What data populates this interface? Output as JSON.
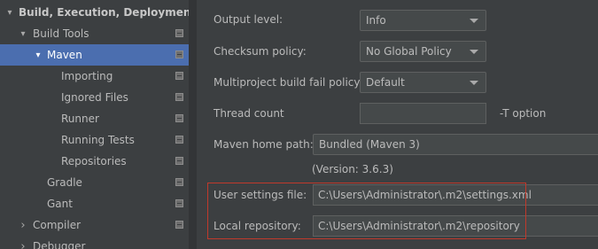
{
  "tree": {
    "items": [
      {
        "label": "Build, Execution, Deployment",
        "arrow": "▾",
        "bold": true,
        "icon": "none"
      },
      {
        "label": "Build Tools",
        "arrow": "▾",
        "icon": "project-page-icon"
      },
      {
        "label": "Maven",
        "arrow": "▾",
        "selected": true,
        "icon": "project-page-icon"
      },
      {
        "label": "Importing",
        "icon": "project-page-icon"
      },
      {
        "label": "Ignored Files",
        "icon": "project-page-icon"
      },
      {
        "label": "Runner",
        "icon": "project-page-icon"
      },
      {
        "label": "Running Tests",
        "icon": "project-page-icon"
      },
      {
        "label": "Repositories",
        "icon": "project-page-icon"
      },
      {
        "label": "Gradle",
        "icon": "project-page-icon"
      },
      {
        "label": "Gant",
        "icon": "project-page-icon"
      },
      {
        "label": "Compiler",
        "arrow": "›",
        "icon": "project-page-icon"
      },
      {
        "label": "Debugger",
        "arrow": "›",
        "icon": "none"
      }
    ]
  },
  "settings": {
    "output_level": {
      "label": "Output level:",
      "value": "Info"
    },
    "checksum_policy": {
      "label": "Checksum policy:",
      "value": "No Global Policy"
    },
    "multiproject_fail_policy": {
      "label": "Multiproject build fail policy:",
      "value": "Default"
    },
    "thread_count": {
      "label": "Thread count",
      "value": "",
      "hint": "-T option"
    },
    "maven_home": {
      "label": "Maven home path:",
      "value": "Bundled (Maven 3)",
      "version": "(Version: 3.6.3)"
    },
    "user_settings_file": {
      "label": "User settings file:",
      "value": "C:\\Users\\Administrator\\.m2\\settings.xml"
    },
    "local_repository": {
      "label": "Local repository:",
      "value": "C:\\Users\\Administrator\\.m2\\repository"
    }
  },
  "colors": {
    "background": "#3c3f41",
    "selection": "#4b6eaf",
    "field": "#45494a",
    "highlight_border": "#c0392b"
  }
}
